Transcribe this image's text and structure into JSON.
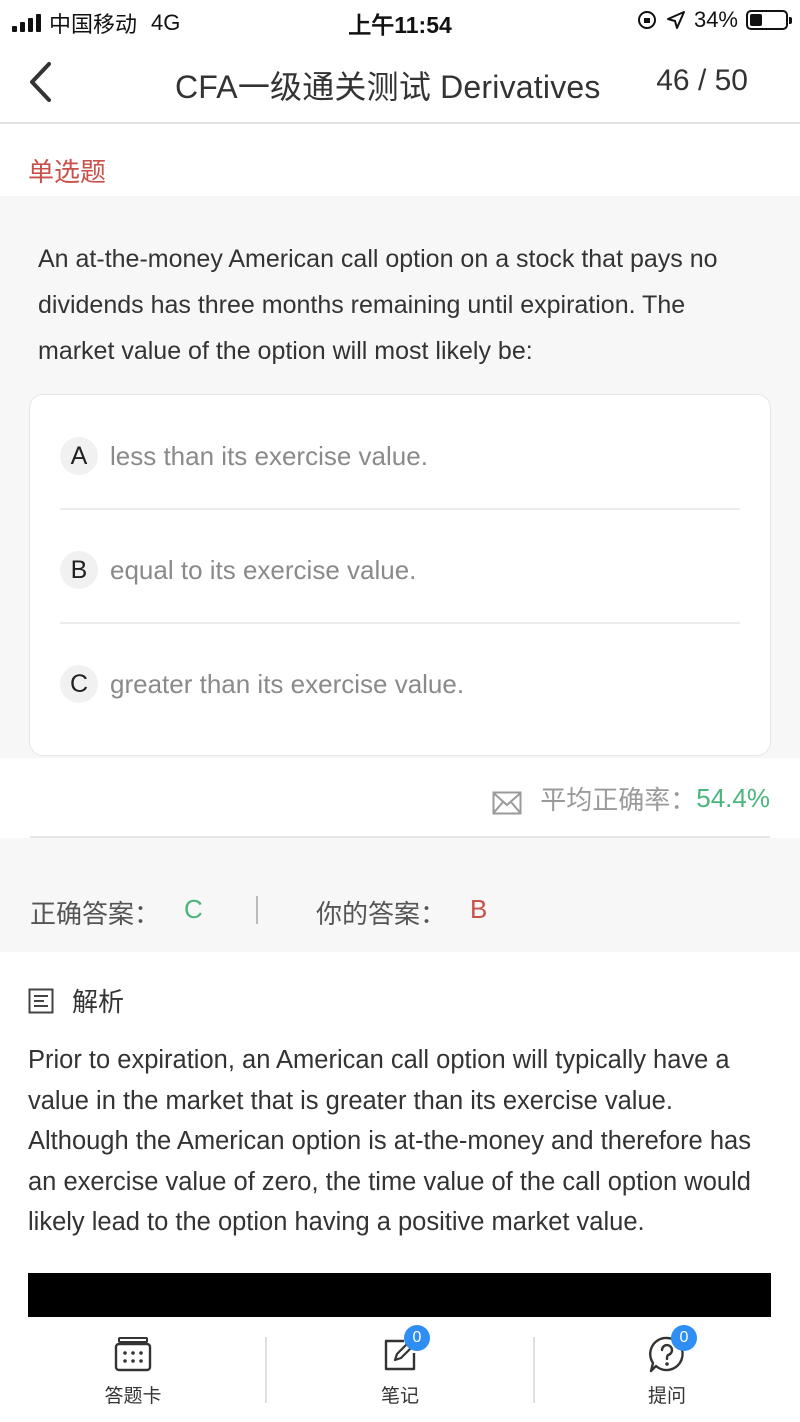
{
  "status_bar": {
    "carrier": "中国移动",
    "network": "4G",
    "time": "上午11:54",
    "battery": "34%",
    "battery_level": 0.34
  },
  "nav": {
    "title": "CFA一级通关测试 Derivatives",
    "progress": "46 / 50",
    "back_icon": "chevron-left-icon"
  },
  "question": {
    "type": "单选题",
    "text": "An at-the-money American call option on a stock that pays no dividends has three months remaining until expiration. The market value of the option will most likely be:",
    "options": [
      {
        "letter": "A",
        "text": "less than its exercise value."
      },
      {
        "letter": "B",
        "text": "equal to its exercise value."
      },
      {
        "letter": "C",
        "text": "greater than its exercise value."
      }
    ]
  },
  "stats": {
    "icon": "mail-icon",
    "label": "平均正确率：",
    "value": "54.4%"
  },
  "answers": {
    "correct_label": "正确答案：",
    "correct_value": "C",
    "yours_label": "你的答案：",
    "yours_value": "B"
  },
  "analysis": {
    "icon": "document-icon",
    "title": "解析",
    "text": "Prior to expiration, an American call option will typically have a value in the market that is greater than its exercise value. Although the American option is at-the-money and therefore has an exercise value of zero, the time value of the call option would likely lead to the option having a positive market value."
  },
  "tab_bar": {
    "tabs": [
      {
        "label": "答题卡",
        "icon": "answer-card-icon"
      },
      {
        "label": "笔记",
        "icon": "note-edit-icon",
        "badge": "0"
      },
      {
        "label": "提问",
        "icon": "question-bubble-icon",
        "badge": "0"
      }
    ]
  },
  "colors": {
    "accent_red": "#c9504a",
    "accent_green": "#4ab67b",
    "badge_blue": "#2f8ef4"
  }
}
